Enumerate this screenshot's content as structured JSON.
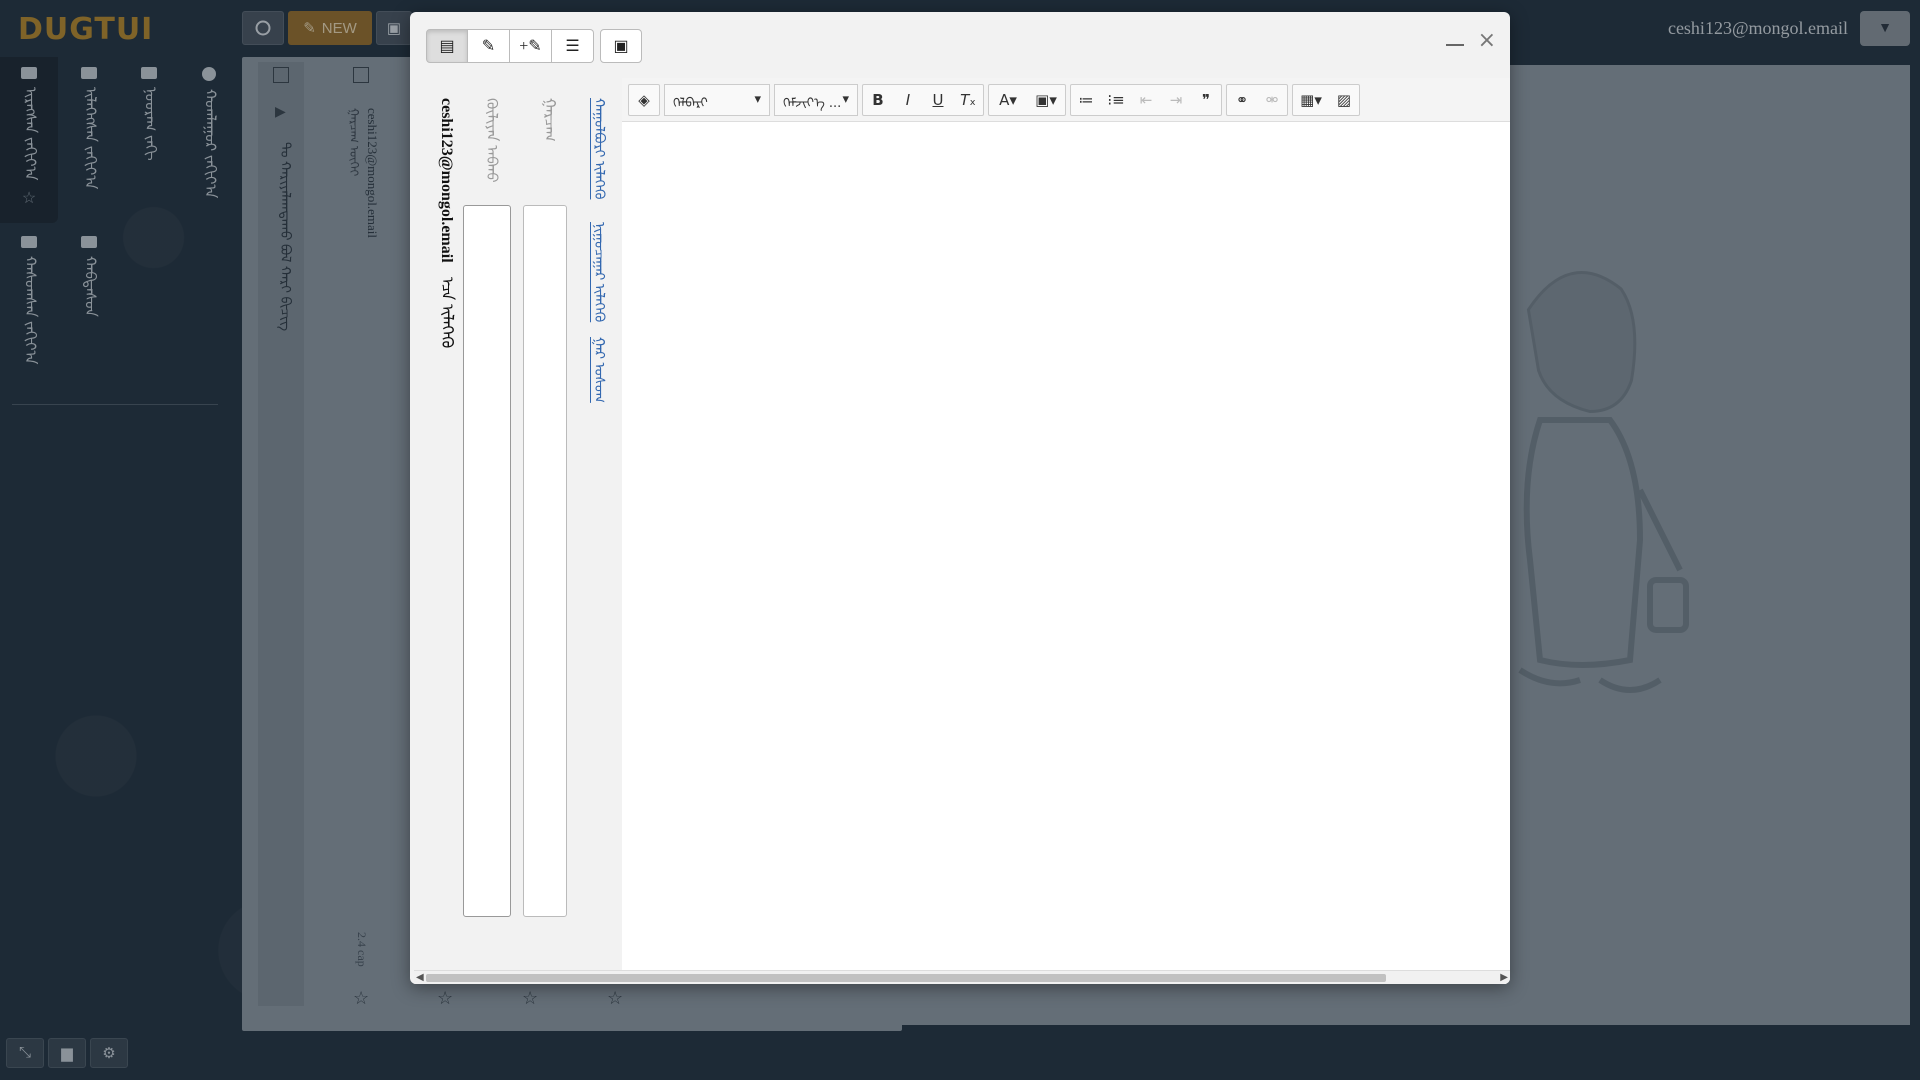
{
  "app": {
    "logo": "DUGTUI"
  },
  "topbar": {
    "refresh_icon": "refresh-icon",
    "new_label": "NEW",
    "user_email": "ceshi123@mongol.email",
    "menu_icon": "▼"
  },
  "sidebar": {
    "items": [
      {
        "label": "ᠢᠷᠡᠭᠰᠡᠨ ᠵᠠᠬᠢᠶ᠎ᠠ",
        "icon": "inbox-icon"
      },
      {
        "label": "ᠢᠯᠡᠭᠡᠭᠰᠡᠨ ᠵᠠᠬᠢᠶ᠎ᠠ",
        "icon": "sent-icon"
      },
      {
        "label": "ᠨᠣᠣᠷᠠᠭ ᠵᠠᠬᠢ",
        "icon": "drafts-icon"
      },
      {
        "label": "ᠬᠣᠭᠯᠠᠭᠤᠷ ᠵᠠᠬᠢᠶ᠎ᠠ",
        "icon": "trash-icon"
      },
      {
        "label": "ᠬᠠᠰᠤᠭᠰᠠᠨ ᠵᠠᠬᠢᠶ᠎ᠠ",
        "icon": "deleted-icon"
      },
      {
        "label": "ᠬᠠᠪᠲᠠᠰᠤᠨ",
        "icon": "folder-icon"
      }
    ]
  },
  "maillist": {
    "col1_text": "ᠲᠤ ᠬᠠᠷᠢᠶᠠᠯᠠᠭᠳᠠᠬᠤ ᠪᠣᠯ ᠬᠠᠷᠢ ᠪᠢᠴᠢᠭ",
    "sender": "ceshi123@mongol.email",
    "subject": "ᠭᠠᠷᠴᠠᠭ ᠦᠭᠡᠢ",
    "time": "2.4 сар"
  },
  "compose": {
    "from_address": "ceshi123@mongol.email",
    "from_suffix": "ᠡᠴᠡ ᠢᠯᠡᠭᠡᠬᠦ",
    "to_label": "ᠬᠦᠯᠢᠶᠡᠨ ᠠᠪᠬᠤ",
    "cc_label": "ᠭᠠᠷᠴᠠᠭ",
    "link_cc": "ᠬᠠᠭᠤᠯᠪᠤᠷᠢ ᠢᠯᠡᠭᠡᠬᠦ",
    "link_bcc": "ᠨᠢᠭᠤᠴᠠᠭᠠᠷ ᠢᠯᠡᠭᠡᠬᠦ",
    "link_sign": "ᠭᠠᠷ ᠤᠰᠤᠭ",
    "font_select": "ᠬᠡᠯᠪᠡᠷᠢ",
    "size_select": "ᠬᠡᠮᠵᠢᠶ᠎ᠡ ..."
  }
}
